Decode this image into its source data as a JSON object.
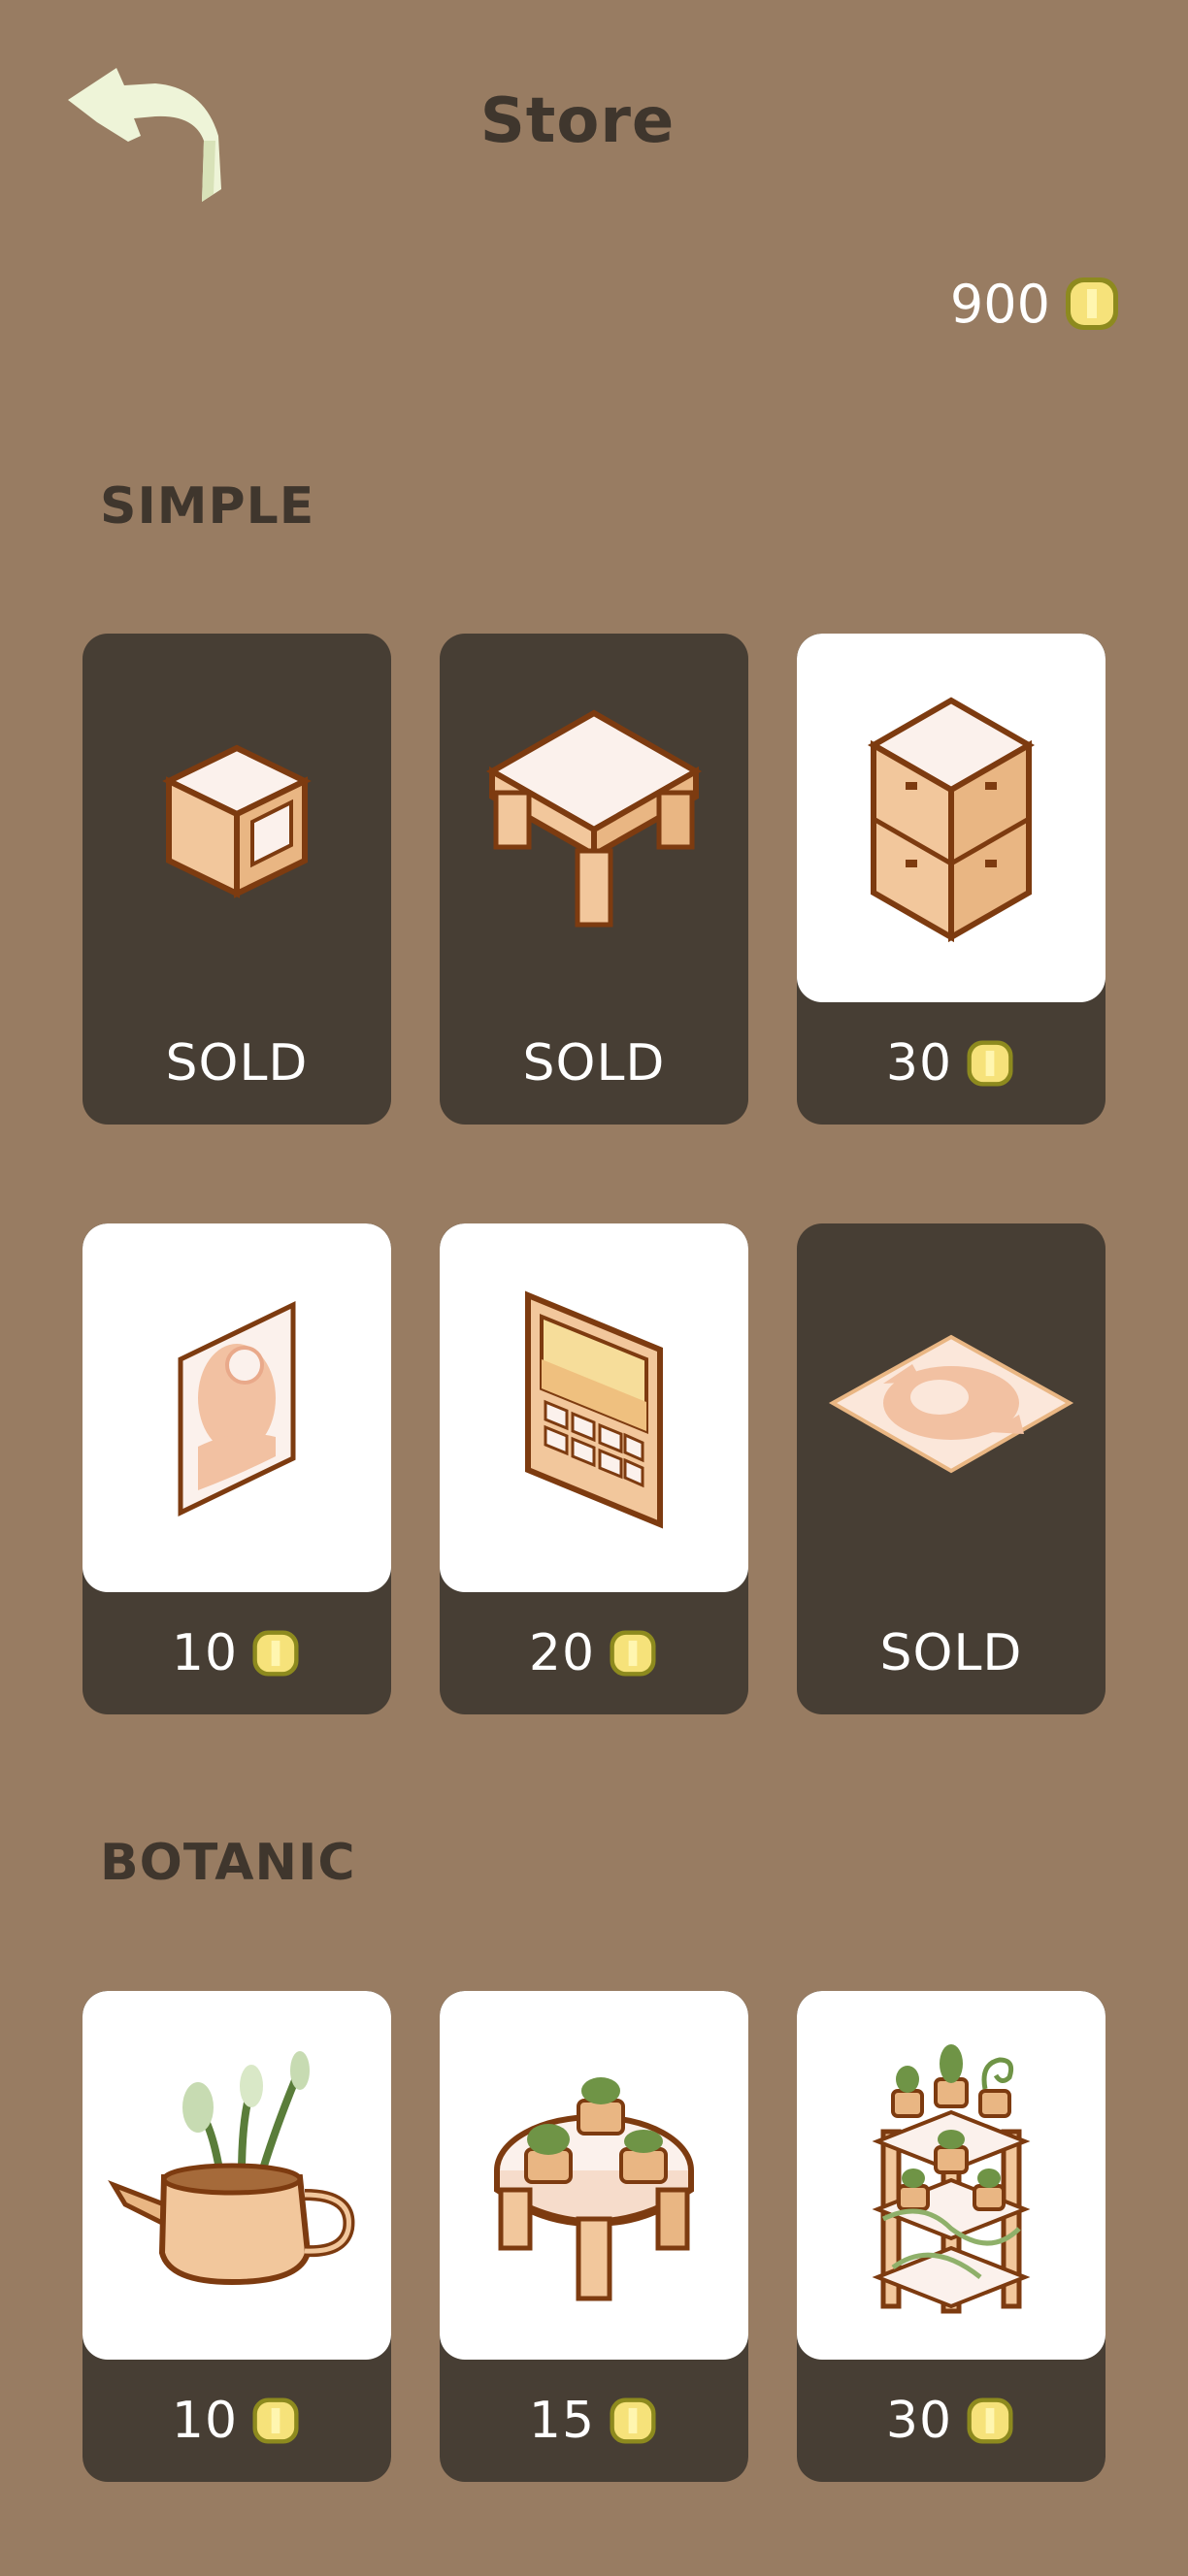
{
  "header": {
    "back_icon": "back-arrow-icon",
    "title": "Store"
  },
  "balance": {
    "amount": "900",
    "icon": "coin-icon"
  },
  "colors": {
    "background": "#987c62",
    "card_dark": "#473e34",
    "card_art": "#ffffff",
    "coin": "#f6e27a",
    "heading": "#3f362d"
  },
  "sections": [
    {
      "title": "SIMPLE",
      "items": [
        {
          "icon": "crate-icon",
          "sold": true,
          "label": "SOLD"
        },
        {
          "icon": "table-icon",
          "sold": true,
          "label": "SOLD"
        },
        {
          "icon": "drawer-chest-icon",
          "sold": false,
          "label": "30"
        },
        {
          "icon": "wall-picture-icon",
          "sold": false,
          "label": "10"
        },
        {
          "icon": "window-icon",
          "sold": false,
          "label": "20"
        },
        {
          "icon": "rug-icon",
          "sold": true,
          "label": "SOLD"
        }
      ]
    },
    {
      "title": "BOTANIC",
      "items": [
        {
          "icon": "watering-can-plant-icon",
          "sold": false,
          "label": "10"
        },
        {
          "icon": "plant-table-icon",
          "sold": false,
          "label": "15"
        },
        {
          "icon": "plant-shelf-icon",
          "sold": false,
          "label": "30"
        }
      ]
    }
  ]
}
